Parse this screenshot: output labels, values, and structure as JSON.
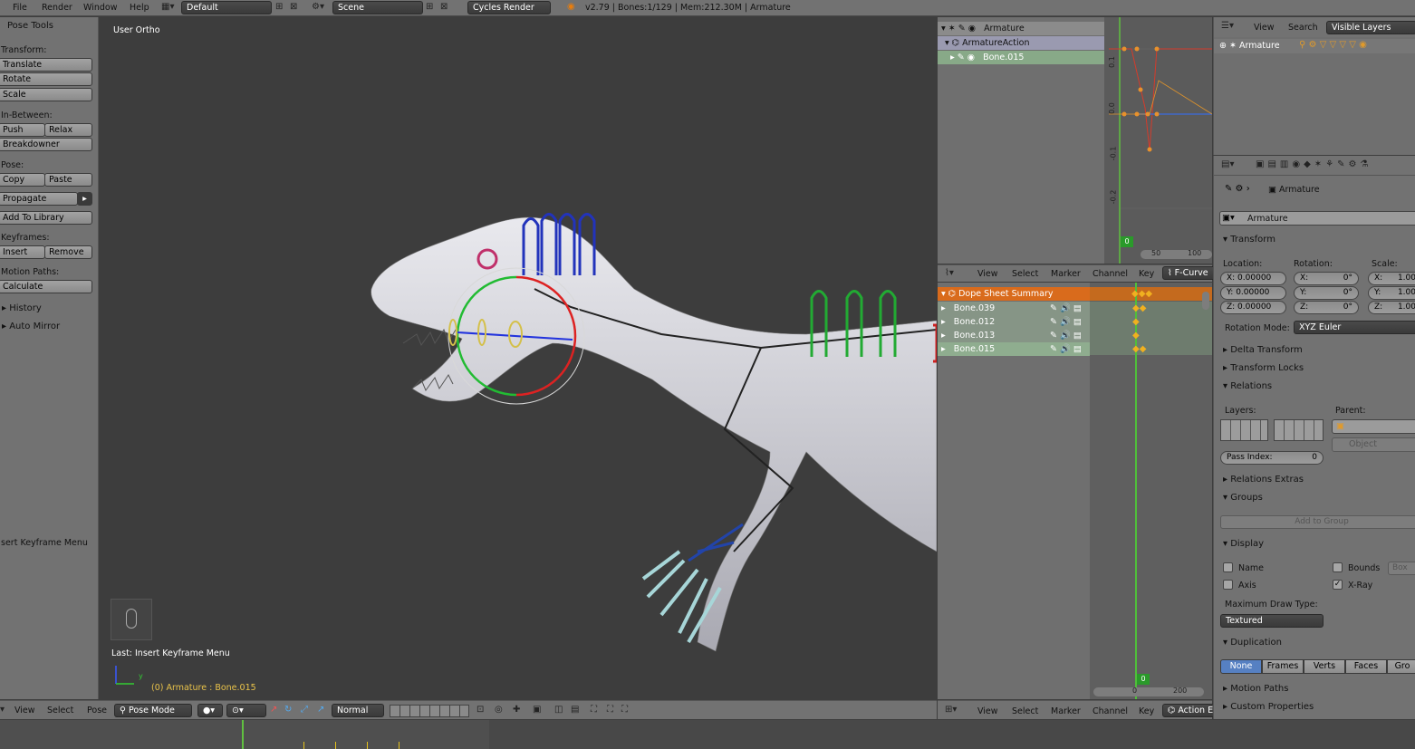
{
  "topbar": {
    "menus": [
      "File",
      "Render",
      "Window",
      "Help"
    ],
    "layout": "Default",
    "scene": "Scene",
    "engine": "Cycles Render",
    "info": "v2.79 | Bones:1/129 | Mem:212.30M | Armature"
  },
  "toolshelf": {
    "title": "Pose Tools",
    "transform_label": "Transform:",
    "translate": "Translate",
    "rotate": "Rotate",
    "scale": "Scale",
    "inbetween_label": "In-Between:",
    "push": "Push",
    "relax": "Relax",
    "breakdowner": "Breakdowner",
    "pose_label": "Pose:",
    "copy": "Copy",
    "paste": "Paste",
    "propagate": "Propagate",
    "add_to_library": "Add To Library",
    "keyframes_label": "Keyframes:",
    "insert": "Insert",
    "remove": "Remove",
    "motion_paths_label": "Motion Paths:",
    "calculate": "Calculate",
    "history": "History",
    "auto_mirror": "Auto Mirror",
    "operator_title": "sert Keyframe Menu"
  },
  "viewport": {
    "view_label": "User Ortho",
    "last_op": "Last: Insert Keyframe Menu",
    "selection": "(0) Armature : Bone.015",
    "axis_y": "y"
  },
  "viewport_header": {
    "menus": [
      "View",
      "Select",
      "Pose"
    ],
    "mode": "Pose Mode",
    "pivot": "Normal"
  },
  "action_outliner": {
    "rows": [
      "Armature",
      "ArmatureAction",
      "Bone.015"
    ]
  },
  "graph_mini": {
    "ticks_y": [
      "0.1",
      "0.0",
      "-0.1",
      "-0.2"
    ],
    "frame": "0",
    "x_ticks": [
      "50",
      "100"
    ]
  },
  "dopesheet_header": {
    "menus": [
      "View",
      "Select",
      "Marker",
      "Channel",
      "Key"
    ],
    "mode": "F-Curve"
  },
  "dopesheet": {
    "summary": "Dope Sheet Summary",
    "channels": [
      "Bone.039",
      "Bone.012",
      "Bone.013",
      "Bone.015"
    ],
    "frame": "0",
    "range_start": "0",
    "range_end": "200"
  },
  "dopesheet_footer": {
    "menus": [
      "View",
      "Select",
      "Marker",
      "Channel",
      "Key"
    ],
    "mode": "Action E"
  },
  "outliner": {
    "menus": [
      "View",
      "Search"
    ],
    "filter": "Visible Layers",
    "item": "Armature"
  },
  "properties": {
    "breadcrumb": "Armature",
    "object_name": "Armature",
    "transform": "Transform",
    "location_label": "Location:",
    "rotation_label": "Rotation:",
    "scale_label": "Scale:",
    "loc": [
      "X: 0.00000",
      "Y: 0.00000",
      "Z: 0.00000"
    ],
    "rot": [
      [
        "X:",
        "0°"
      ],
      [
        "Y:",
        "0°"
      ],
      [
        "Z:",
        "0°"
      ]
    ],
    "scl": [
      "X:",
      "1.00",
      "Y:",
      "1.00",
      "Z:",
      "1.00"
    ],
    "rotation_mode_label": "Rotation Mode:",
    "rotation_mode": "XYZ Euler",
    "delta_transform": "Delta Transform",
    "transform_locks": "Transform Locks",
    "relations": "Relations",
    "layers_label": "Layers:",
    "parent_label": "Parent:",
    "parent_type": "Object",
    "pass_index_label": "Pass Index:",
    "pass_index": "0",
    "relations_extras": "Relations Extras",
    "groups": "Groups",
    "add_to_group": "Add to Group",
    "display": "Display",
    "name": "Name",
    "bounds": "Bounds",
    "bounds_type": "Box",
    "axis": "Axis",
    "xray": "X-Ray",
    "max_draw_label": "Maximum Draw Type:",
    "max_draw": "Textured",
    "duplication": "Duplication",
    "dup_opts": [
      "None",
      "Frames",
      "Verts",
      "Faces",
      "Gro"
    ],
    "motion_paths": "Motion Paths",
    "custom_properties": "Custom Properties"
  }
}
